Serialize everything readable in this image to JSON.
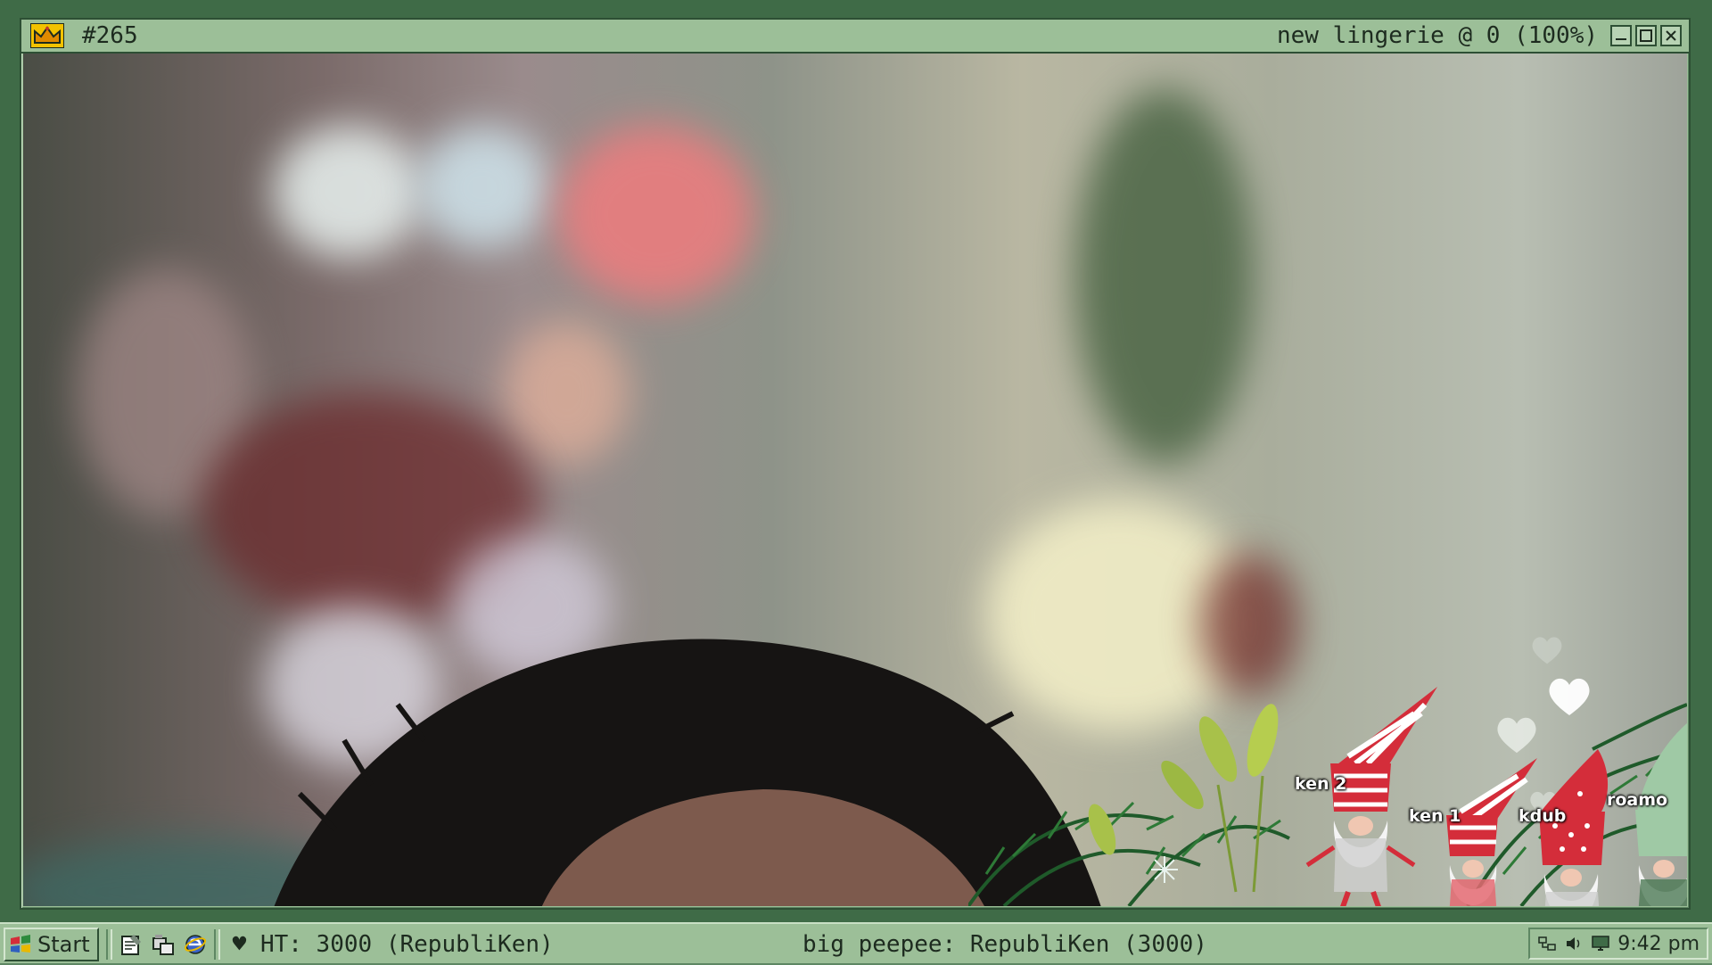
{
  "window": {
    "number": "#265",
    "status": "new lingerie @ 0 (100%)",
    "icon": "crown-icon"
  },
  "overlay": {
    "gnomes": [
      {
        "label": "ken 2"
      },
      {
        "label": "ken 1"
      },
      {
        "label": "kdub"
      },
      {
        "label": "roamo"
      }
    ]
  },
  "taskbar": {
    "start_label": "Start",
    "ticker_left": "♥ HT: 3000 (RepubliKen)",
    "ticker_center": "big peepee: RepubliKen (3000)",
    "clock": "9:42 pm"
  },
  "colors": {
    "frame": "#9cbf98",
    "border": "#2d4f34",
    "background": "#3f6b47"
  }
}
